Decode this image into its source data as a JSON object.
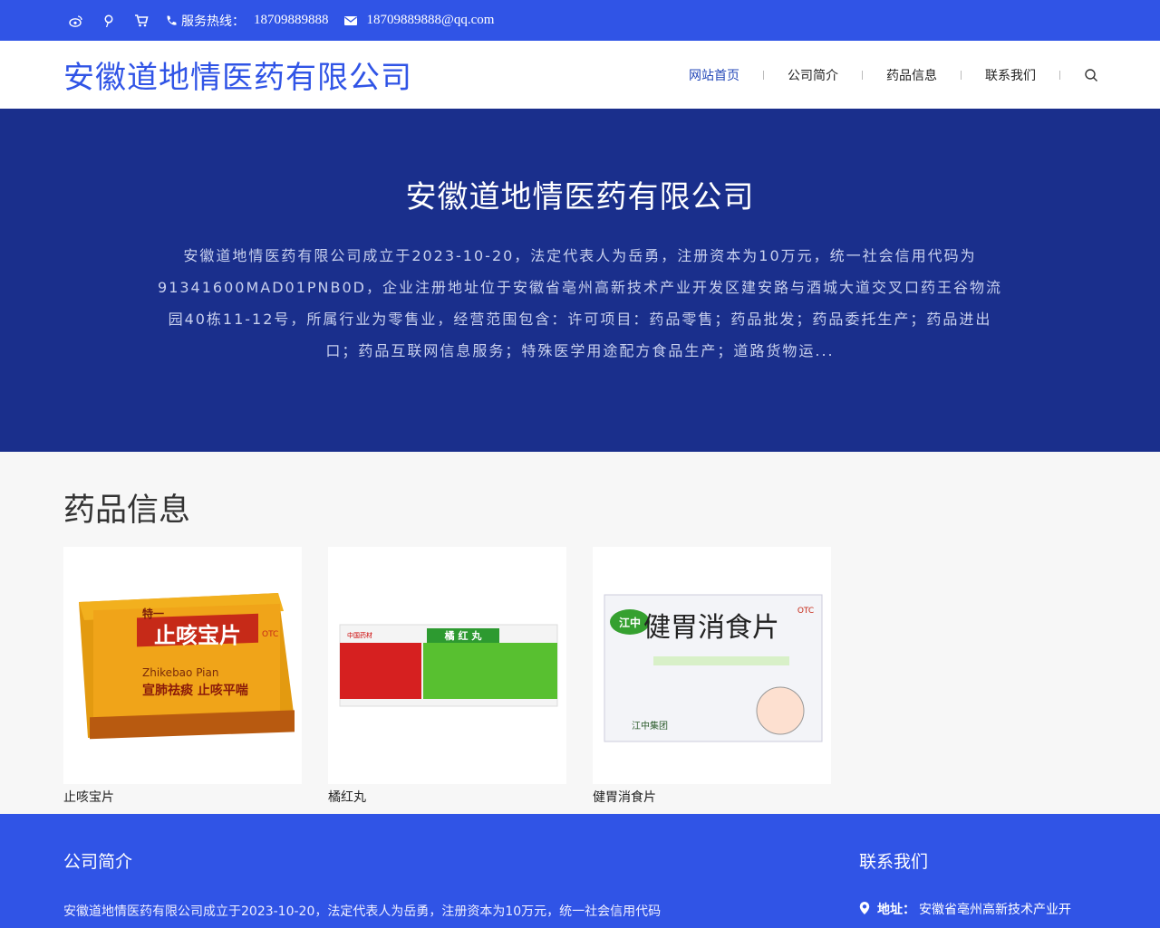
{
  "topbar": {
    "hotline_label": "服务热线：",
    "hotline_number": "18709889888",
    "email": "18709889888@qq.com"
  },
  "header": {
    "logo": "安徽道地情医药有限公司",
    "nav": [
      "网站首页",
      "公司简介",
      "药品信息",
      "联系我们"
    ]
  },
  "hero": {
    "title": "安徽道地情医药有限公司",
    "description": "安徽道地情医药有限公司成立于2023-10-20，法定代表人为岳勇，注册资本为10万元，统一社会信用代码为91341600MAD01PNB0D，企业注册地址位于安徽省亳州高新技术产业开发区建安路与酒城大道交叉口药王谷物流园40栋11-12号，所属行业为零售业，经营范围包含：许可项目：药品零售；药品批发；药品委托生产；药品进出口；药品互联网信息服务；特殊医学用途配方食品生产；道路货物运..."
  },
  "products": {
    "title": "药品信息",
    "items": [
      {
        "name": "止咳宝片",
        "brand": "特一",
        "box_title": "止咳宝片",
        "pinyin": "Zhikebao Pian",
        "slogan": "宣肺祛痰 止咳平喘",
        "badge": "OTC"
      },
      {
        "name": "橘红丸",
        "box_title": "橘 红 丸",
        "brand": "中国药材"
      },
      {
        "name": "健胃消食片",
        "brand": "江中",
        "box_title": "健胃消食片",
        "badge": "OTC",
        "group": "江中集团"
      }
    ]
  },
  "footer": {
    "about_title": "公司简介",
    "about_text": "安徽道地情医药有限公司成立于2023-10-20，法定代表人为岳勇，注册资本为10万元，统一社会信用代码",
    "contact_title": "联系我们",
    "address_label": "地址：",
    "address_value": "安徽省亳州高新技术产业开"
  },
  "colors": {
    "primary": "#3054e6",
    "hero_bg": "#1a2f8c"
  }
}
